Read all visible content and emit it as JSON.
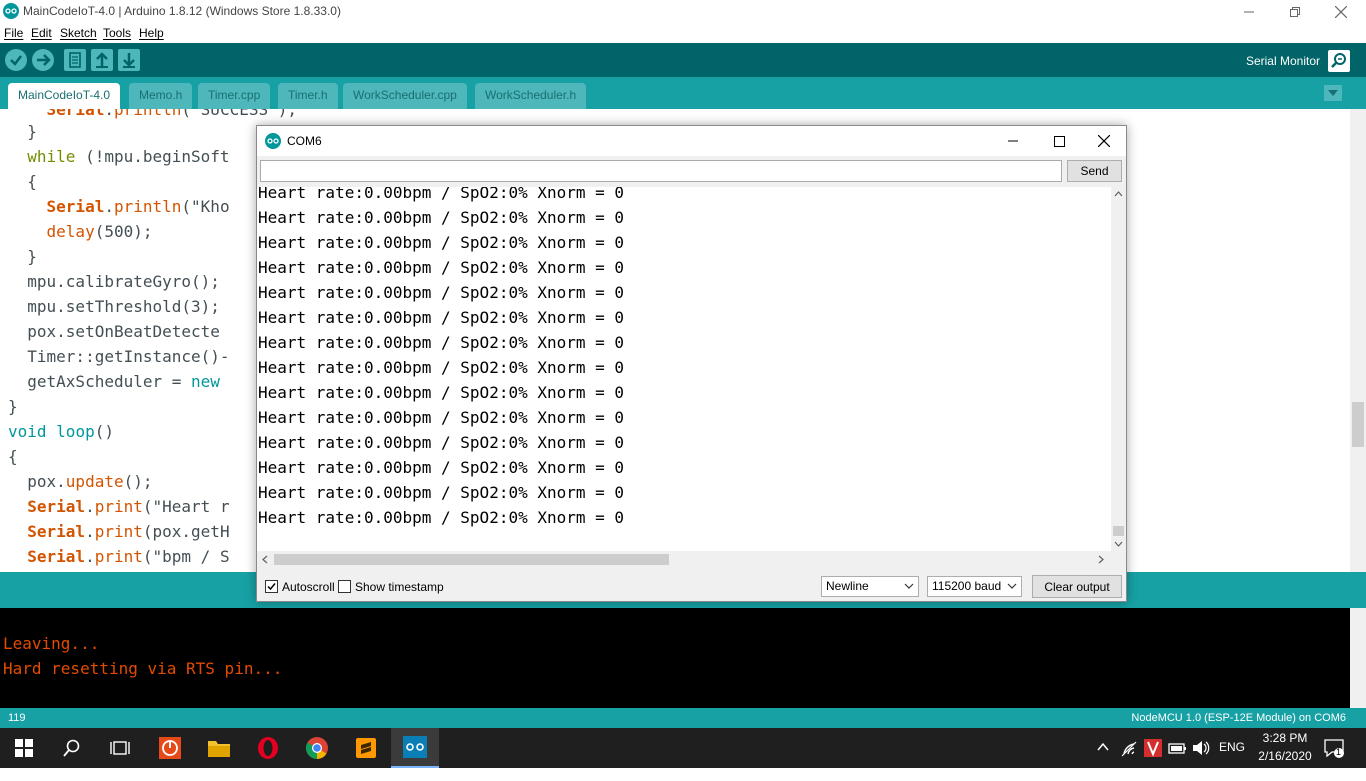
{
  "window": {
    "title": "MainCodeIoT-4.0 | Arduino 1.8.12 (Windows Store 1.8.33.0)"
  },
  "menu": {
    "file": "File",
    "edit": "Edit",
    "sketch": "Sketch",
    "tools": "Tools",
    "help": "Help"
  },
  "toolbar": {
    "serial_monitor_label": "Serial Monitor"
  },
  "tabs": [
    {
      "label": "MainCodeIoT-4.0",
      "active": true
    },
    {
      "label": "Memo.h"
    },
    {
      "label": "Timer.cpp"
    },
    {
      "label": "Timer.h"
    },
    {
      "label": "WorkScheduler.cpp"
    },
    {
      "label": "WorkScheduler.h"
    }
  ],
  "code_lines": [
    "    Serial.println(\"SUCCESS\");",
    "  }",
    "  while (!mpu.beginSoft",
    "  {",
    "    Serial.println(\"Kho",
    "    delay(500);",
    "  }",
    "  mpu.calibrateGyro();",
    "  mpu.setThreshold(3);",
    "  pox.setOnBeatDetecte",
    "  Timer::getInstance()-",
    "  getAxScheduler = new",
    "}",
    "void loop()",
    "{",
    "  pox.update();",
    "  Serial.print(\"Heart r",
    "  Serial.print(pox.getH",
    "  Serial.print(\"bpm / S"
  ],
  "console": {
    "lines": [
      "Leaving...",
      "Hard resetting via RTS pin..."
    ]
  },
  "statusbar": {
    "line_number": "119",
    "board": "NodeMCU 1.0 (ESP-12E Module) on COM6"
  },
  "serial_monitor": {
    "title": "COM6",
    "input_value": "",
    "send_label": "Send",
    "output_lines": [
      "Heart rate:0.00bpm / SpO2:0% Xnorm = 0",
      "Heart rate:0.00bpm / SpO2:0% Xnorm = 0",
      "Heart rate:0.00bpm / SpO2:0% Xnorm = 0",
      "Heart rate:0.00bpm / SpO2:0% Xnorm = 0",
      "Heart rate:0.00bpm / SpO2:0% Xnorm = 0",
      "Heart rate:0.00bpm / SpO2:0% Xnorm = 0",
      "Heart rate:0.00bpm / SpO2:0% Xnorm = 0",
      "Heart rate:0.00bpm / SpO2:0% Xnorm = 0",
      "Heart rate:0.00bpm / SpO2:0% Xnorm = 0",
      "Heart rate:0.00bpm / SpO2:0% Xnorm = 0",
      "Heart rate:0.00bpm / SpO2:0% Xnorm = 0",
      "Heart rate:0.00bpm / SpO2:0% Xnorm = 0",
      "Heart rate:0.00bpm / SpO2:0% Xnorm = 0",
      "Heart rate:0.00bpm / SpO2:0% Xnorm = 0"
    ],
    "autoscroll_label": "Autoscroll",
    "autoscroll_checked": true,
    "timestamp_label": "Show timestamp",
    "timestamp_checked": false,
    "line_ending": "Newline",
    "baud": "115200 baud",
    "clear_label": "Clear output"
  },
  "taskbar": {
    "language": "ENG",
    "time": "3:28 PM",
    "date": "2/16/2020",
    "notification_count": "1"
  },
  "colors": {
    "toolbar": "#006468",
    "tabbar": "#17a1a5",
    "console_text": "#e34c00"
  }
}
